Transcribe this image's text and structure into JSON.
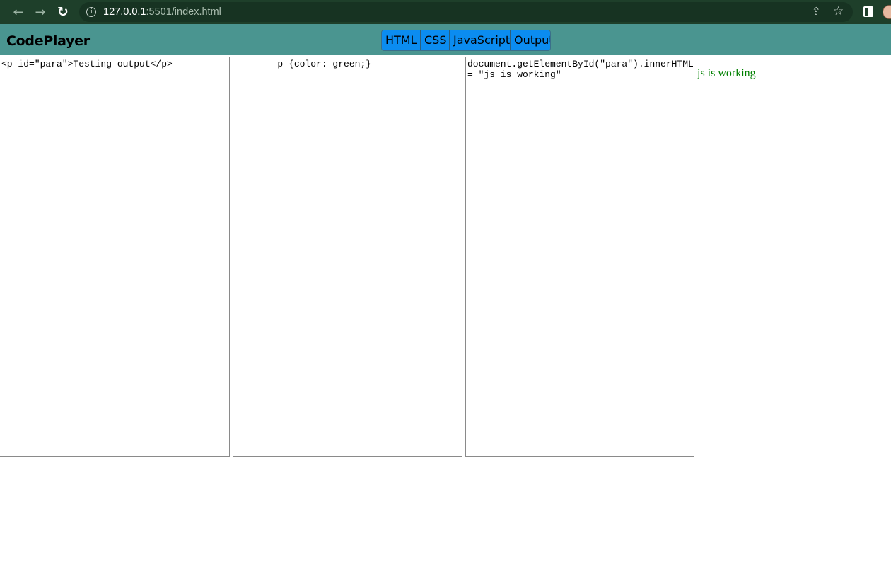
{
  "browser": {
    "url_host": "127.0.0.1",
    "url_rest": ":5501/index.html",
    "back_icon": "←",
    "forward_icon": "→",
    "reload_icon": "↻",
    "info_icon": "i",
    "share_icon": "⇪",
    "star_icon": "☆"
  },
  "app": {
    "logo": "CodePlayer",
    "toggles": [
      "HTML",
      "CSS",
      "JavaScript",
      "Output"
    ],
    "accent_color": "#0b8cf0",
    "header_color": "#4a9590"
  },
  "panels": {
    "html_code": "<p id=\"para\">Testing output</p>",
    "css_code": "        p {color: green;}",
    "js_code": "document.getElementById(\"para\").innerHTML = \"js is working\""
  },
  "output": {
    "text": "js is working",
    "text_color": "#008000"
  }
}
